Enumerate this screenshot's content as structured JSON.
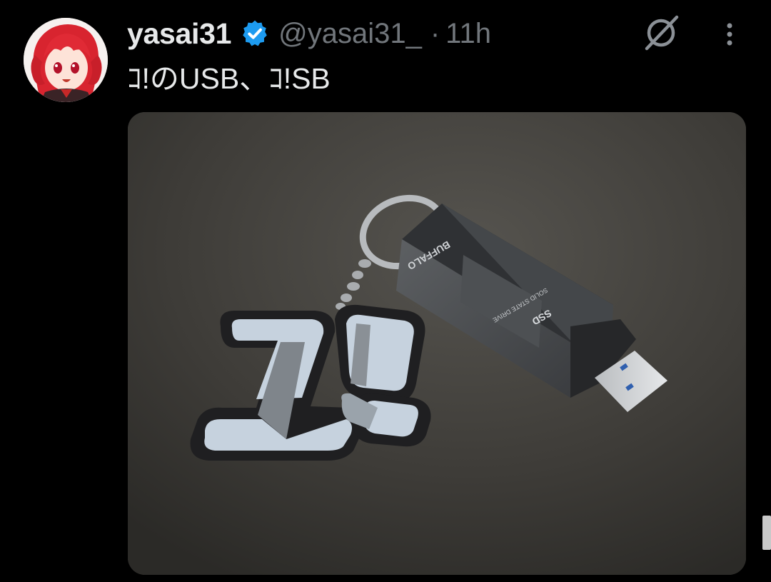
{
  "tweet": {
    "display_name": "yasai31",
    "verified": true,
    "handle": "@yasai31_",
    "separator": "·",
    "time": "11h",
    "text": "ｺ!のUSB、ｺ!SB",
    "avatar_icon": "avatar-image",
    "media": {
      "description_icon": "photo",
      "brand_label": "BUFFALO",
      "product_label": "SSD",
      "product_sub": "SOLID STATE DRIVE"
    }
  },
  "actions": {
    "grok_icon": "grok-icon",
    "more_icon": "more-vertical-icon"
  },
  "colors": {
    "background": "#000000",
    "primary_text": "#e7e9ea",
    "secondary_text": "#71767b",
    "verified_blue": "#1d9bf0"
  }
}
